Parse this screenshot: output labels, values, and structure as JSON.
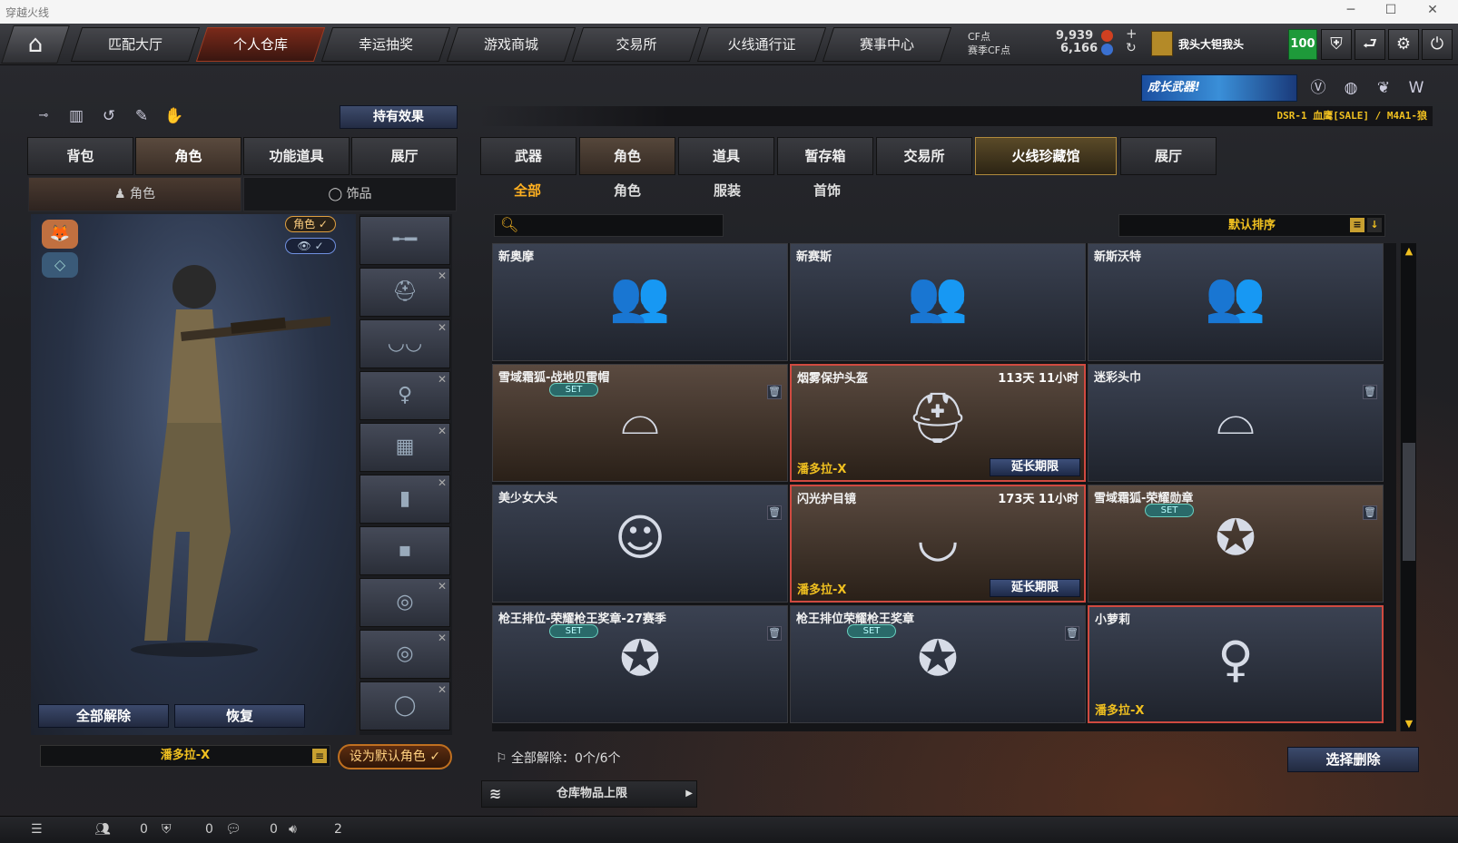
{
  "window": {
    "title": "穿越火线"
  },
  "nav": {
    "tabs": [
      "匹配大厅",
      "个人仓库",
      "幸运抽奖",
      "游戏商城",
      "交易所",
      "火线通行证",
      "赛事中心"
    ]
  },
  "currency": {
    "cf_label": "CF点",
    "cf_value": "9,939",
    "event_label": "赛季CF点",
    "event_value": "6,166",
    "plus": "+",
    "refresh": "↻"
  },
  "user": {
    "name": "我头大钽我头",
    "level": "100"
  },
  "promo": {
    "text": "成长武器!"
  },
  "ticker": {
    "text": "DSR-1 血鹰[SALE] / M4A1-狼"
  },
  "left": {
    "hold_effect": "持有效果",
    "tabs": [
      "背包",
      "角色",
      "功能道具",
      "展厅"
    ],
    "subtabs": [
      "角色",
      "饰品"
    ],
    "badge_role": "角色 ✓",
    "btn_release": "全部解除",
    "btn_restore": "恢复",
    "character_name": "潘多拉-X",
    "set_default": "设为默认角色 ✓"
  },
  "right": {
    "tabs": [
      "武器",
      "角色",
      "道具",
      "暂存箱",
      "交易所",
      "火线珍藏馆",
      "展厅"
    ],
    "subtabs": [
      "全部",
      "角色",
      "服装",
      "首饰"
    ],
    "search_placeholder": "",
    "sort": "默认排序",
    "release_info": "全部解除：0个/6个",
    "delete_selected": "选择删除",
    "capacity": "仓库物品上限"
  },
  "items": [
    {
      "name": "新奥摩",
      "time": "",
      "set": "",
      "owner": "",
      "extend": ""
    },
    {
      "name": "新赛斯",
      "time": "",
      "set": "",
      "owner": "",
      "extend": ""
    },
    {
      "name": "新斯沃特",
      "time": "",
      "set": "",
      "owner": "",
      "extend": ""
    },
    {
      "name": "雪域霜狐-战地贝雷帽",
      "time": "",
      "set": "SET",
      "owner": "",
      "extend": ""
    },
    {
      "name": "烟雾保护头盔",
      "time": "113天 11小时",
      "set": "",
      "owner": "潘多拉-X",
      "extend": "延长期限"
    },
    {
      "name": "迷彩头巾",
      "time": "",
      "set": "",
      "owner": "",
      "extend": ""
    },
    {
      "name": "美少女大头",
      "time": "",
      "set": "",
      "owner": "",
      "extend": ""
    },
    {
      "name": "闪光护目镜",
      "time": "173天 11小时",
      "set": "",
      "owner": "潘多拉-X",
      "extend": "延长期限"
    },
    {
      "name": "雪域霜狐-荣耀勋章",
      "time": "",
      "set": "SET",
      "owner": "",
      "extend": ""
    },
    {
      "name": "枪王排位-荣耀枪王奖章-27赛季",
      "time": "",
      "set": "SET",
      "owner": "",
      "extend": ""
    },
    {
      "name": "枪王排位荣耀枪王奖章",
      "time": "",
      "set": "SET",
      "owner": "",
      "extend": ""
    },
    {
      "name": "小萝莉",
      "time": "",
      "set": "",
      "owner": "潘多拉-X",
      "extend": ""
    }
  ],
  "status": {
    "c1": "0",
    "c2": "0",
    "c3": "0",
    "c4": "2"
  }
}
